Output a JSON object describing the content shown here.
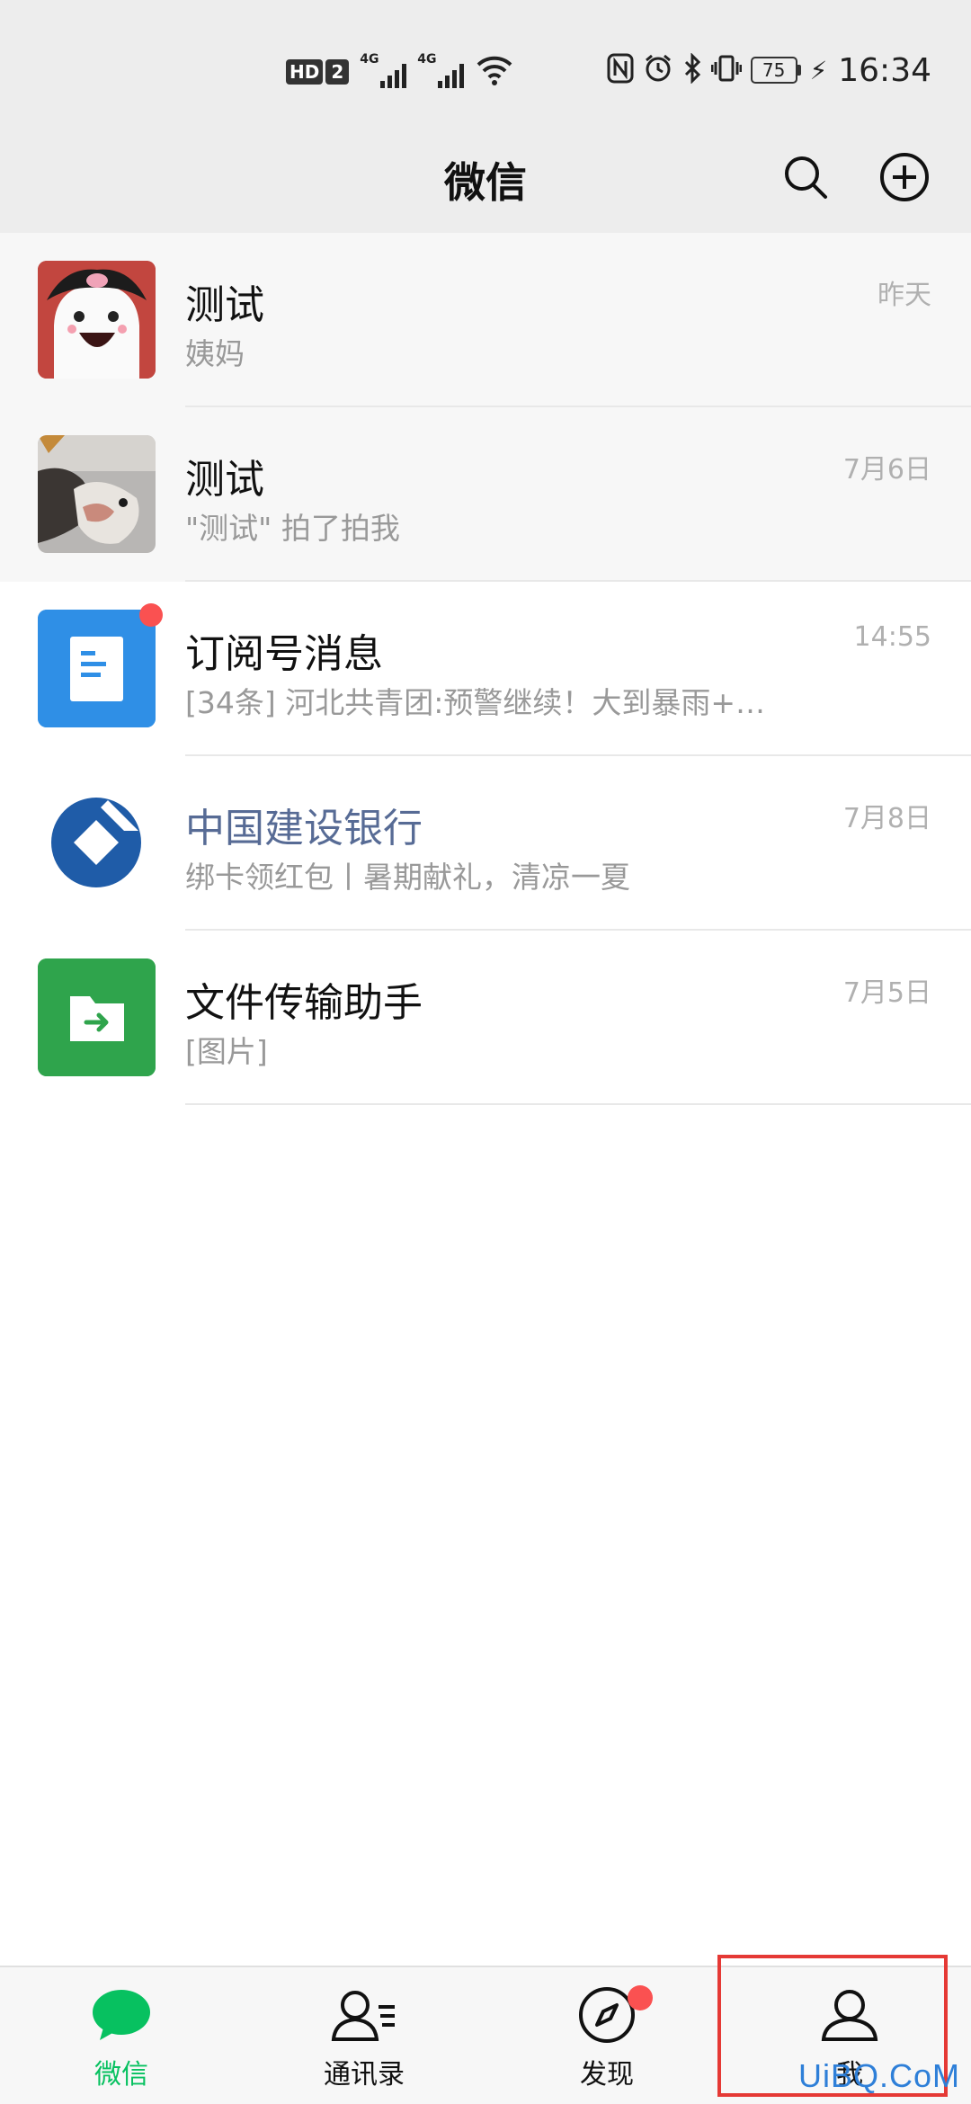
{
  "status_bar": {
    "hd_label": "HD",
    "hd_sim": "2",
    "signal_1": "4G",
    "signal_2": "4G",
    "battery": "75",
    "time": "16:34",
    "icons": [
      "hd-icon",
      "signal-icon",
      "wifi-icon",
      "nfc-icon",
      "alarm-icon",
      "bluetooth-icon",
      "vibrate-icon",
      "battery-icon",
      "charging-icon"
    ]
  },
  "header": {
    "title": "微信",
    "icons": [
      "search-icon",
      "add-circle-icon"
    ]
  },
  "chats": [
    {
      "name": "测试",
      "preview": "姨妈",
      "time": "昨天",
      "pinned": true,
      "avatar": "cartoon-avatar"
    },
    {
      "name": "测试",
      "preview": "\"测试\" 拍了拍我",
      "time": "7月6日",
      "pinned": true,
      "avatar": "dog-photo-avatar"
    },
    {
      "name": "订阅号消息",
      "preview": "[34条] 河北共青团:预警继续！大到暴雨+…",
      "time": "14:55",
      "pinned": false,
      "avatar": "subscription-icon",
      "unread_dot": true
    },
    {
      "name": "中国建设银行",
      "preview": "绑卡领红包丨暑期献礼，清凉一夏",
      "time": "7月8日",
      "pinned": false,
      "avatar": "ccb-logo",
      "service": true
    },
    {
      "name": "文件传输助手",
      "preview": "[图片]",
      "time": "7月5日",
      "pinned": false,
      "avatar": "file-transfer-icon"
    }
  ],
  "bottom_nav": {
    "items": [
      {
        "label": "微信",
        "icon": "chat-bubble-icon",
        "active": true
      },
      {
        "label": "通讯录",
        "icon": "contacts-icon",
        "active": false
      },
      {
        "label": "发现",
        "icon": "compass-icon",
        "active": false,
        "dot": true
      },
      {
        "label": "我",
        "icon": "person-icon",
        "active": false
      }
    ]
  },
  "watermark": "UiBQ.CoM",
  "colors": {
    "accent": "#07c160",
    "badge": "#fa5151",
    "service_name": "#576b95",
    "highlight": "#e53935"
  }
}
